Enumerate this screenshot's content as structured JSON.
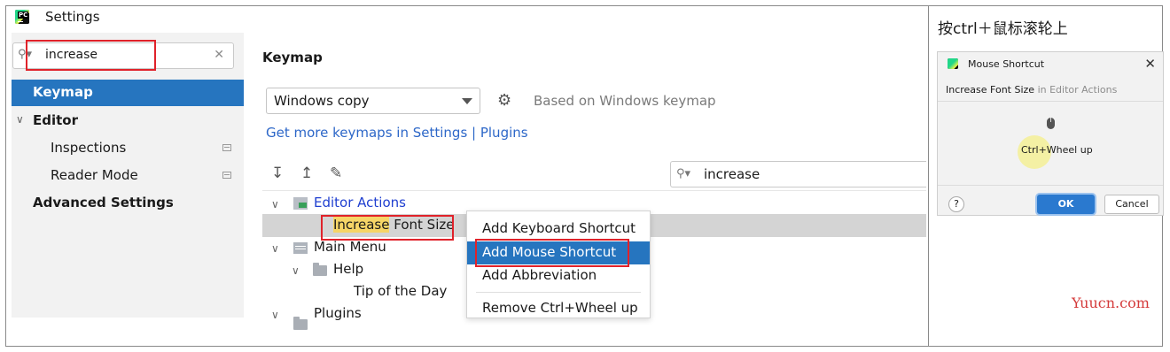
{
  "window": {
    "title": "Settings",
    "logo": "PC"
  },
  "sidebar": {
    "search_value": "increase",
    "items": [
      {
        "label": "Keymap"
      },
      {
        "label": "Editor"
      },
      {
        "label": "Inspections"
      },
      {
        "label": "Reader Mode"
      },
      {
        "label": "Advanced Settings"
      }
    ]
  },
  "main": {
    "heading": "Keymap",
    "scheme_value": "Windows copy",
    "based_on": "Based on Windows keymap",
    "get_more_link": "Get more keymaps in Settings | Plugins",
    "filter_value": "increase",
    "tree": {
      "editor_actions": "Editor Actions",
      "increase_hl": "Increase",
      "font_size_rest": " Font Size",
      "main_menu": "Main Menu",
      "help": "Help",
      "tip_of_day": "Tip of the Day",
      "plugins": "Plugins"
    }
  },
  "context_menu": {
    "items": [
      {
        "label": "Add Keyboard Shortcut"
      },
      {
        "label": "Add Mouse Shortcut"
      },
      {
        "label": "Add Abbreviation"
      },
      {
        "label": "Remove Ctrl+Wheel up"
      }
    ],
    "active_index": 1
  },
  "tip": {
    "caption": "按ctrl＋鼠标滚轮上"
  },
  "dialog": {
    "title": "Mouse Shortcut",
    "subtitle_action": "Increase Font Size",
    "subtitle_context": " in Editor Actions",
    "shortcut": "Ctrl+Wheel up",
    "help": "?",
    "ok": "OK",
    "cancel": "Cancel"
  },
  "watermark": "Yuucn.com",
  "colors": {
    "accent": "#2675bf",
    "highlight_border": "#e0222a",
    "search_match": "#f6d567"
  }
}
